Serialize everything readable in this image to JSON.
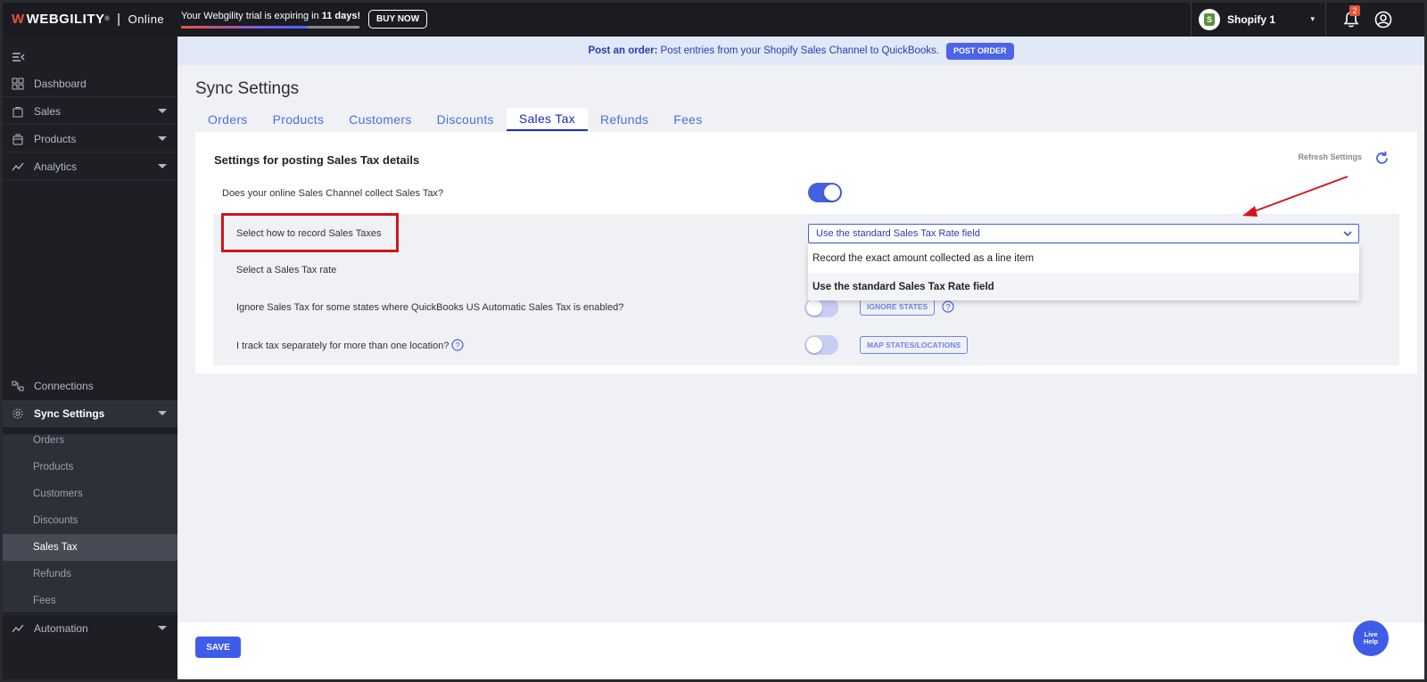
{
  "topbar": {
    "brand": "WEBGILITY",
    "brand_mark": "W",
    "edition": "Online",
    "trial_prefix": "Your Webgility trial is expiring in ",
    "trial_days": "11 days!",
    "buy_now": "BUY NOW",
    "store_name": "Shopify 1",
    "notification_count": "2"
  },
  "sidebar": {
    "items": [
      {
        "label": "Dashboard"
      },
      {
        "label": "Sales"
      },
      {
        "label": "Products"
      },
      {
        "label": "Analytics"
      },
      {
        "label": "Connections"
      },
      {
        "label": "Sync Settings"
      },
      {
        "label": "Automation"
      }
    ],
    "sub_items": [
      {
        "label": "Orders"
      },
      {
        "label": "Products"
      },
      {
        "label": "Customers"
      },
      {
        "label": "Discounts"
      },
      {
        "label": "Sales Tax"
      },
      {
        "label": "Refunds"
      },
      {
        "label": "Fees"
      }
    ]
  },
  "banner": {
    "bold": "Post an order:",
    "text": "Post entries from your Shopify Sales Channel to QuickBooks.",
    "button": "POST ORDER"
  },
  "page": {
    "title": "Sync Settings",
    "tabs": [
      {
        "label": "Orders"
      },
      {
        "label": "Products"
      },
      {
        "label": "Customers"
      },
      {
        "label": "Discounts"
      },
      {
        "label": "Sales Tax"
      },
      {
        "label": "Refunds"
      },
      {
        "label": "Fees"
      }
    ],
    "active_tab": "Sales Tax"
  },
  "settings": {
    "title": "Settings for posting Sales Tax details",
    "refresh_label": "Refresh Settings",
    "q_collect": "Does your online Sales Channel collect Sales Tax?",
    "q_collect_on": true,
    "q_record": "Select how to record Sales Taxes",
    "record_value": "Use the standard Sales Tax Rate field",
    "record_options": [
      "Record the exact amount collected as a line item",
      "Use the standard Sales Tax Rate field"
    ],
    "q_rate": "Select a Sales Tax rate",
    "q_ignore": "Ignore Sales Tax for some states where QuickBooks US Automatic Sales Tax is enabled?",
    "ignore_button": "IGNORE STATES",
    "q_track": "I track tax separately for more than one location?",
    "map_button": "MAP STATES/LOCATIONS"
  },
  "footer": {
    "save": "SAVE",
    "live_help_1": "Live",
    "live_help_2": "Help"
  },
  "colors": {
    "accent": "#4660e2",
    "highlight": "#d4141c",
    "sidebar_bg": "#1e1f24"
  }
}
